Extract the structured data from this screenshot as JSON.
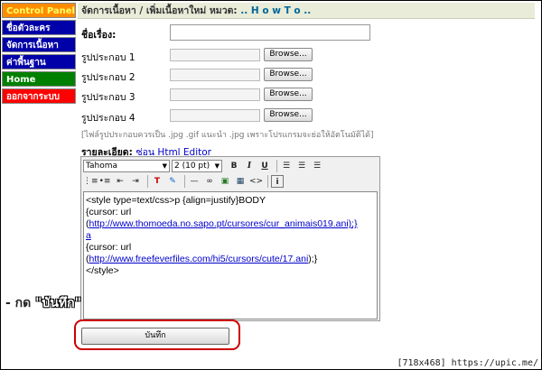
{
  "sidebar": {
    "items": [
      {
        "label": "Control Panel"
      },
      {
        "label": "ชื่อตัวละคร"
      },
      {
        "label": "จัดการเนื้อหา"
      },
      {
        "label": "ค่าพื้นฐาน"
      },
      {
        "label": "Home"
      },
      {
        "label": "ออกจากระบบ"
      }
    ]
  },
  "header": {
    "prefix": "จัดการเนื้อหา / เพิ่มเนื้อหาใหม่ หมวด:",
    "category_link": ".. H o w T o .."
  },
  "form": {
    "title_label": "ชื่อเรื่อง:",
    "title_value": "",
    "image_labels": [
      "รูปประกอบ 1",
      "รูปประกอบ 2",
      "รูปประกอบ 3",
      "รูปประกอบ 4"
    ],
    "browse_label": "Browse...",
    "note": "[ไฟล์รูปประกอบควรเป็น .jpg .gif แนะนำ .jpg เพราะโปรแกรมจะย่อให้อัตโนมัติได้]",
    "detail_label": "รายละเอียด:",
    "hide_editor_link": "ซ่อน Html Editor",
    "save_label": "บันทึก"
  },
  "editor": {
    "font": "Tahoma",
    "size": "2 (10 pt)",
    "toolbar_icons": [
      "bold-icon",
      "italic-icon",
      "underline-icon",
      "align-left-icon",
      "align-center-icon",
      "align-right-icon",
      "ordered-list-icon",
      "unordered-list-icon",
      "outdent-icon",
      "indent-icon",
      "text-color-icon",
      "highlight-icon",
      "horizontal-rule-icon",
      "link-icon",
      "image-icon",
      "table-icon",
      "html-source-icon",
      "info-icon"
    ],
    "lines": {
      "l1": "<style type=text/css>p {align=justify}BODY",
      "l2": "{cursor: url",
      "l3a": "(",
      "l3b": "http://www.thomoeda.no.sapo.pt/cursores/cur_animais019.ani);}",
      "l4": "a",
      "l5": "{cursor: url",
      "l6a": "(",
      "l6b": "http://www.freefeverfiles.com/hi5/cursors/cute/17.ani",
      "l6c": ");}",
      "l7": "</style>"
    }
  },
  "annotation": {
    "prefix": "- กด",
    "quoted": "\"บันทึก\""
  },
  "footer": "[718x468] https://upic.me/"
}
